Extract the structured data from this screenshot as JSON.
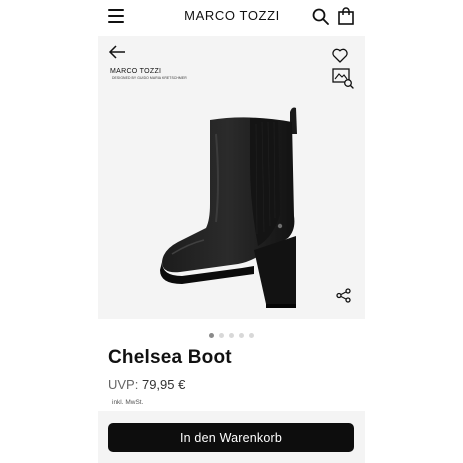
{
  "header": {
    "brand": "MARCO TOZZI",
    "menu_icon": "hamburger-menu-icon",
    "search_icon": "search-icon",
    "bag_icon": "shopping-bag-icon"
  },
  "stage": {
    "logo_name": "MARCO TOZZI",
    "logo_tagline": "DESIGNED BY GUIDO MARIA KRETSCHMER",
    "back_icon": "arrow-left-icon",
    "wishlist_icon": "heart-icon",
    "photo_search_icon": "image-search-icon",
    "share_icon": "share-icon"
  },
  "gallery": {
    "total_images": 5,
    "active_index": 0
  },
  "product": {
    "title": "Chelsea Boot",
    "price_label": "UVP:",
    "price_value": "79,95 €",
    "vat_note": "inkl. MwSt."
  },
  "cart": {
    "button_label": "In den Warenkorb"
  },
  "colors": {
    "stage_background": "#f4f4f4",
    "cart_button": "#0d0d0d",
    "dot_active": "#8a8a8a",
    "dot_inactive": "#d8d8d8"
  }
}
